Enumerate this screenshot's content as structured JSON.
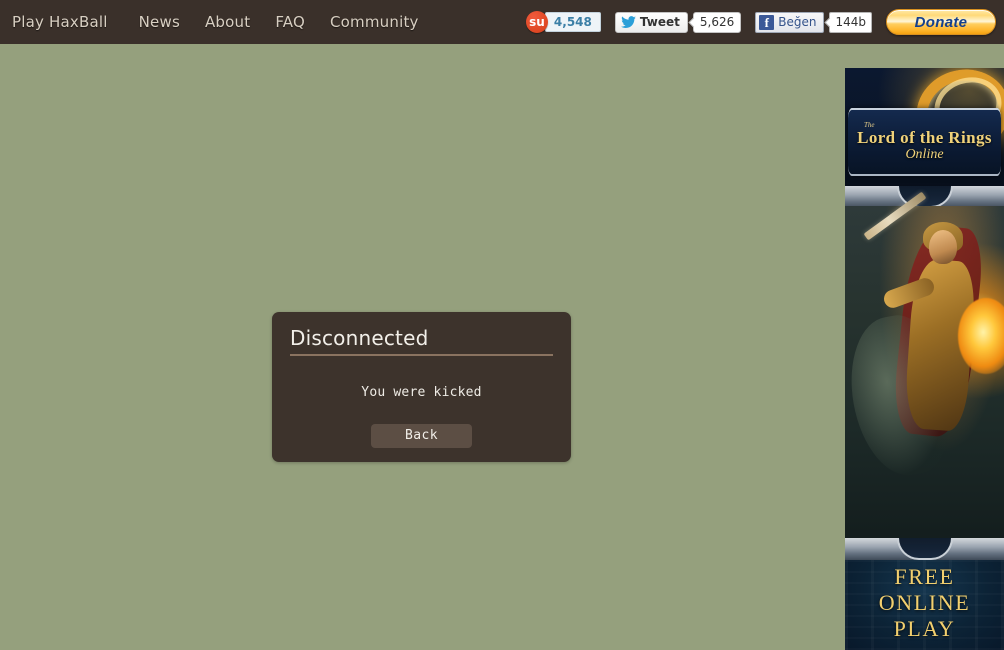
{
  "header": {
    "nav": [
      {
        "label": "Play HaxBall",
        "name": "nav-play-haxball"
      },
      {
        "label": "News",
        "name": "nav-news"
      },
      {
        "label": "About",
        "name": "nav-about"
      },
      {
        "label": "FAQ",
        "name": "nav-faq"
      },
      {
        "label": "Community",
        "name": "nav-community"
      }
    ],
    "social": {
      "stumbleupon": {
        "icon": "stumbleupon-icon",
        "glyph": "su",
        "count": "4,548"
      },
      "twitter": {
        "icon": "twitter-bird-icon",
        "label": "Tweet",
        "count": "5,626"
      },
      "facebook": {
        "icon": "facebook-f-icon",
        "glyph": "f",
        "label": "Beğen",
        "count": "144b"
      },
      "donate": {
        "label": "Donate"
      }
    }
  },
  "dialog": {
    "title": "Disconnected",
    "message": "You were kicked",
    "back_label": "Back"
  },
  "ad": {
    "logo_the": "The",
    "logo_main": "Lord of the Rings",
    "logo_online": "Online",
    "cta": [
      "FREE",
      "ONLINE",
      "PLAY"
    ]
  },
  "colors": {
    "page_background": "#95a07d",
    "header_background": "#3a302a",
    "dialog_background": "#3d332c",
    "dialog_rule": "#8a7360",
    "button_background": "#5c4e44",
    "nav_text": "#d8cfc2",
    "donate_text": "#14408f",
    "ad_gold": "#f0d27a"
  }
}
